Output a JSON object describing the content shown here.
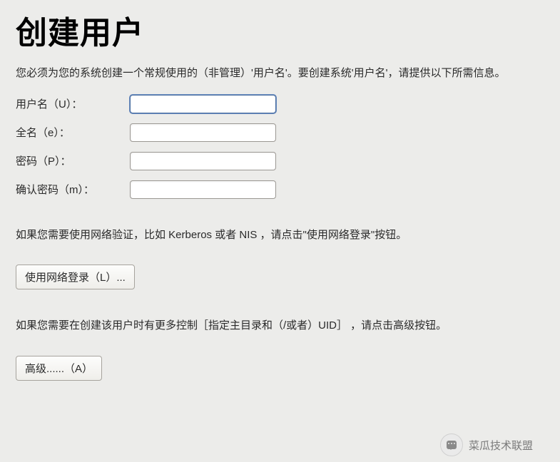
{
  "header": {
    "title": "创建用户"
  },
  "description": "您必须为您的系统创建一个常规使用的（非管理）'用户名'。要创建系统'用户名'，请提供以下所需信息。",
  "form": {
    "username": {
      "label": "用户名（U）：",
      "value": ""
    },
    "fullname": {
      "label": "全名（e）：",
      "value": ""
    },
    "password": {
      "label": "密码（P）：",
      "value": ""
    },
    "confirm": {
      "label": "确认密码（m）：",
      "value": ""
    }
  },
  "network_section": {
    "text": "如果您需要使用网络验证，比如 Kerberos 或者 NIS ，请点击\"使用网络登录\"按钮。",
    "button_label": "使用网络登录（L）..."
  },
  "advanced_section": {
    "text": "如果您需要在创建该用户时有更多控制［指定主目录和（/或者）UID］ ，请点击高级按钮。",
    "button_label": "高级......（A）"
  },
  "watermark": {
    "text": "菜瓜技术联盟"
  }
}
